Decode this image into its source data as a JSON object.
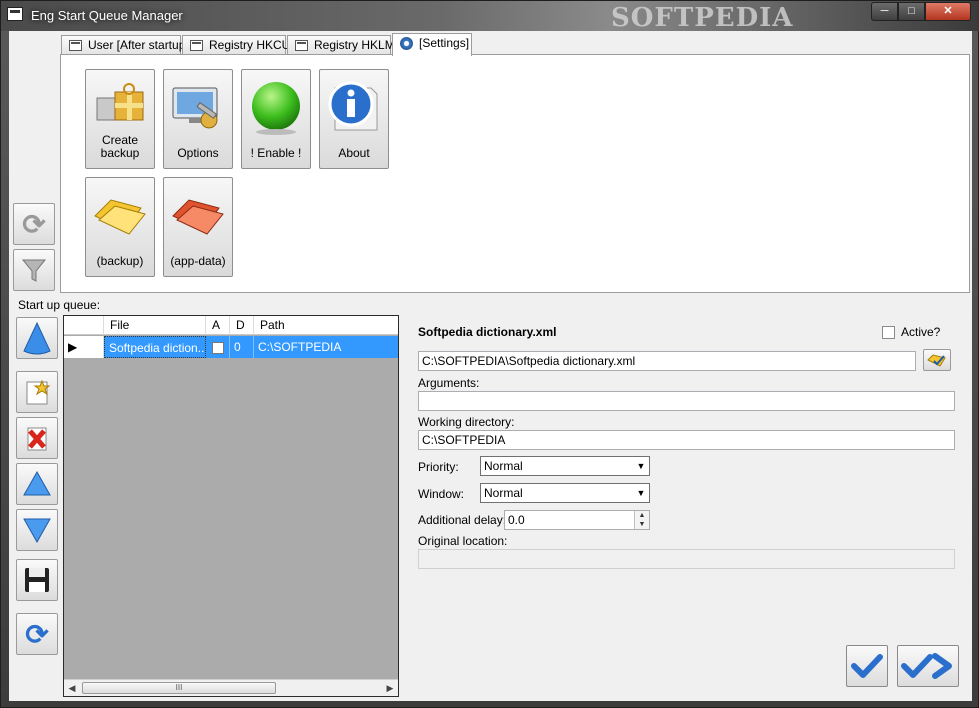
{
  "window": {
    "title": "Eng Start Queue Manager",
    "watermark": "SOFTPEDIA",
    "minimize": "─",
    "maximize": "□",
    "close": "✕"
  },
  "tabs": [
    {
      "label": "User [After startup]"
    },
    {
      "label": "Registry HKCU"
    },
    {
      "label": "Registry HKLM"
    },
    {
      "label": "[Settings]"
    }
  ],
  "settings_buttons": [
    {
      "label": "Create backup",
      "icon": "gift-box-icon"
    },
    {
      "label": "Options",
      "icon": "tools-icon"
    },
    {
      "label": "! Enable !",
      "icon": "green-orb-icon"
    },
    {
      "label": "About",
      "icon": "info-icon"
    },
    {
      "label": "(backup)",
      "icon": "yellow-folder-icon"
    },
    {
      "label": "(app-data)",
      "icon": "red-folder-icon"
    }
  ],
  "queue_label": "Start up queue:",
  "grid": {
    "columns": [
      "File",
      "A",
      "D",
      "Path"
    ],
    "rows": [
      {
        "file": "Softpedia diction...",
        "a": false,
        "d": "0",
        "path": "C:\\SOFTPEDIA"
      }
    ],
    "scroll_grip": "III"
  },
  "details": {
    "title": "Softpedia dictionary.xml",
    "active_label": "Active?",
    "active_checked": false,
    "file_path": "C:\\SOFTPEDIA\\Softpedia dictionary.xml",
    "arguments_label": "Arguments:",
    "arguments_value": "",
    "working_dir_label": "Working directory:",
    "working_dir_value": "C:\\SOFTPEDIA",
    "priority_label": "Priority:",
    "priority_value": "Normal",
    "window_label": "Window:",
    "window_value": "Normal",
    "delay_label": "Additional delay:",
    "delay_value": "0.0",
    "original_location_label": "Original location:",
    "original_location_value": ""
  },
  "colors": {
    "selection": "#3399ff",
    "accent_blue": "#2a6fcc",
    "grid_background": "#ababab"
  }
}
